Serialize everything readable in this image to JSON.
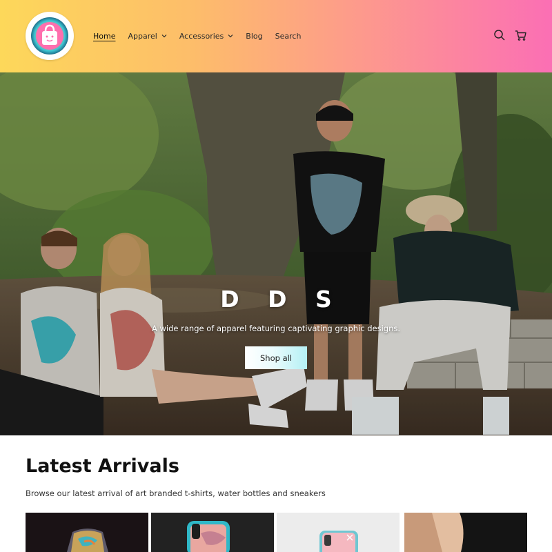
{
  "header": {
    "logo_icon": "shopping-bag-logo",
    "nav": [
      {
        "label": "Home",
        "active": true
      },
      {
        "label": "Apparel",
        "dropdown": true
      },
      {
        "label": "Accessories",
        "dropdown": true
      },
      {
        "label": "Blog"
      },
      {
        "label": "Search"
      }
    ],
    "icons": [
      "search-icon",
      "cart-icon"
    ],
    "gradient": [
      "#fdd85a",
      "#fb6fb4"
    ]
  },
  "hero": {
    "title": "D D S",
    "subtitle": "A wide range of apparel featuring captivating graphic designs.",
    "button_label": "Shop all"
  },
  "latest": {
    "title": "Latest Arrivals",
    "subtitle": "Browse our latest arrival of art branded t-shirts, water bottles and sneakers"
  }
}
